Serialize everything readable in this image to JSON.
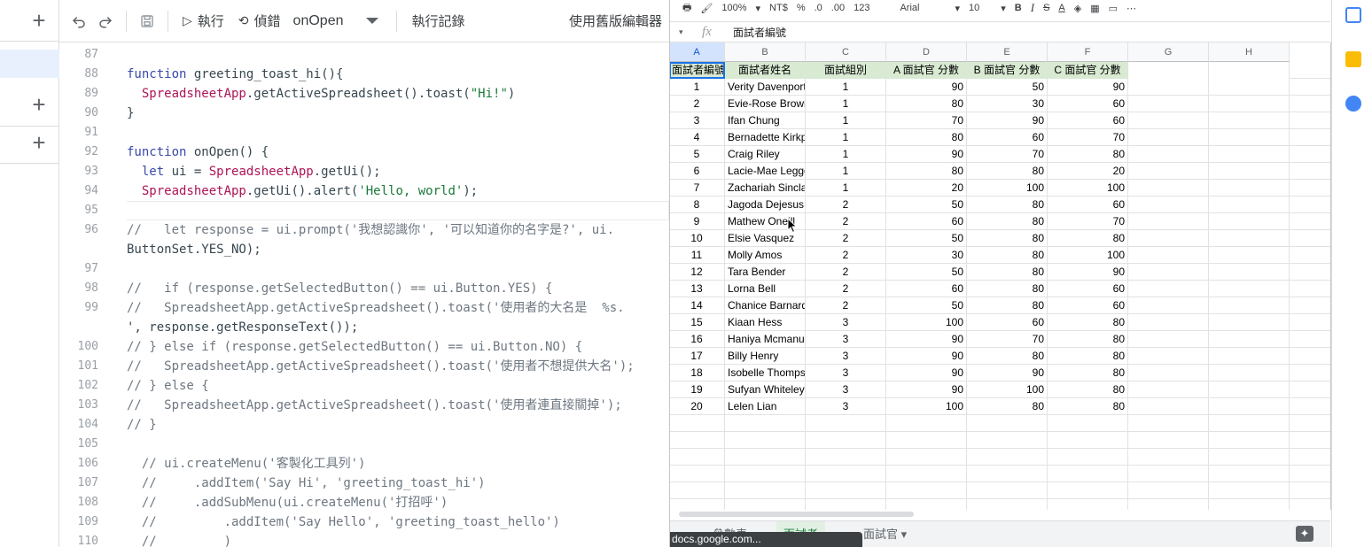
{
  "editor": {
    "toolbar": {
      "undo_icon": "undo-icon",
      "redo_icon": "redo-icon",
      "save_icon": "save-icon",
      "run_label": "執行",
      "debug_label": "偵錯",
      "function_name": "onOpen",
      "exec_log_label": "執行記錄",
      "legacy_label": "使用舊版編輯器"
    },
    "code_lines": [
      {
        "n": "87",
        "t": ""
      },
      {
        "n": "88",
        "t": "function greeting_toast_hi(){"
      },
      {
        "n": "89",
        "t": "  SpreadsheetApp.getActiveSpreadsheet().toast(\"Hi!\")"
      },
      {
        "n": "90",
        "t": "}"
      },
      {
        "n": "91",
        "t": ""
      },
      {
        "n": "92",
        "t": "function onOpen() {"
      },
      {
        "n": "93",
        "t": "  let ui = SpreadsheetApp.getUi();"
      },
      {
        "n": "94",
        "t": "  SpreadsheetApp.getUi().alert('Hello, world');"
      },
      {
        "n": "95",
        "t": ""
      },
      {
        "n": "96",
        "t": "//   let response = ui.prompt('我想認識你', '可以知道你的名字是?', ui."
      },
      {
        "n": "",
        "t": "ButtonSet.YES_NO);"
      },
      {
        "n": "97",
        "t": ""
      },
      {
        "n": "98",
        "t": "//   if (response.getSelectedButton() == ui.Button.YES) {"
      },
      {
        "n": "99",
        "t": "//   SpreadsheetApp.getActiveSpreadsheet().toast('使用者的大名是  %s."
      },
      {
        "n": "",
        "t": "', response.getResponseText());"
      },
      {
        "n": "100",
        "t": "// } else if (response.getSelectedButton() == ui.Button.NO) {"
      },
      {
        "n": "101",
        "t": "//   SpreadsheetApp.getActiveSpreadsheet().toast('使用者不想提供大名');"
      },
      {
        "n": "102",
        "t": "// } else {"
      },
      {
        "n": "103",
        "t": "//   SpreadsheetApp.getActiveSpreadsheet().toast('使用者連直接關掉');"
      },
      {
        "n": "104",
        "t": "// }"
      },
      {
        "n": "105",
        "t": ""
      },
      {
        "n": "106",
        "t": "  // ui.createMenu('客製化工具列')"
      },
      {
        "n": "107",
        "t": "  //     .addItem('Say Hi', 'greeting_toast_hi')"
      },
      {
        "n": "108",
        "t": "  //     .addSubMenu(ui.createMenu('打招呼')"
      },
      {
        "n": "109",
        "t": "  //         .addItem('Say Hello', 'greeting_toast_hello')"
      },
      {
        "n": "110",
        "t": "  //         )"
      }
    ]
  },
  "sheets": {
    "format_bar": {
      "zoom": "100%",
      "currency": "NT$",
      "percent": "%",
      "dec_minus": ".0",
      "dec_plus": ".00",
      "more_formats": "123",
      "font": "Arial",
      "font_size": "10",
      "bold": "B",
      "italic": "I",
      "strike": "S",
      "text_color": "A",
      "more": "⋯"
    },
    "formula_bar": {
      "fx": "fx",
      "value": "面試者編號"
    },
    "columns": [
      "A",
      "B",
      "C",
      "D",
      "E",
      "F",
      "G",
      "H"
    ],
    "header": [
      "面試者編號",
      "面試者姓名",
      "面試組別",
      "A 面試官 分數",
      "B 面試官 分數",
      "C 面試官 分數"
    ],
    "rows": [
      [
        "1",
        "Verity Davenport",
        "1",
        "90",
        "50",
        "90"
      ],
      [
        "2",
        "Evie-Rose Brown",
        "1",
        "80",
        "30",
        "60"
      ],
      [
        "3",
        "Ifan Chung",
        "1",
        "70",
        "90",
        "60"
      ],
      [
        "4",
        "Bernadette Kirkpatrick",
        "1",
        "80",
        "60",
        "70"
      ],
      [
        "5",
        "Craig Riley",
        "1",
        "90",
        "70",
        "80"
      ],
      [
        "6",
        "Lacie-Mae Leggett",
        "1",
        "80",
        "80",
        "20"
      ],
      [
        "7",
        "Zachariah Sinclair",
        "1",
        "20",
        "100",
        "100"
      ],
      [
        "8",
        "Jagoda Dejesus",
        "2",
        "50",
        "80",
        "60"
      ],
      [
        "9",
        "Mathew Oneill",
        "2",
        "60",
        "80",
        "70"
      ],
      [
        "10",
        "Elsie Vasquez",
        "2",
        "50",
        "80",
        "80"
      ],
      [
        "11",
        "Molly Amos",
        "2",
        "30",
        "80",
        "100"
      ],
      [
        "12",
        "Tara Bender",
        "2",
        "50",
        "80",
        "90"
      ],
      [
        "13",
        "Lorna Bell",
        "2",
        "60",
        "80",
        "60"
      ],
      [
        "14",
        "Chanice Barnard",
        "2",
        "50",
        "80",
        "60"
      ],
      [
        "15",
        "Kiaan Hess",
        "3",
        "100",
        "60",
        "80"
      ],
      [
        "16",
        "Haniya Mcmanus",
        "3",
        "90",
        "70",
        "80"
      ],
      [
        "17",
        "Billy Henry",
        "3",
        "90",
        "80",
        "80"
      ],
      [
        "18",
        "Isobelle Thompson",
        "3",
        "90",
        "90",
        "80"
      ],
      [
        "19",
        "Sufyan Whiteley",
        "3",
        "90",
        "100",
        "80"
      ],
      [
        "20",
        "Lelen Lian",
        "3",
        "100",
        "80",
        "80"
      ]
    ],
    "tabs": [
      {
        "label": "參數表",
        "active": false
      },
      {
        "label": "面試者",
        "active": true
      },
      {
        "label": "面試官",
        "active": false
      }
    ],
    "status_url": "docs.google.com...",
    "colors": {
      "header_fill": "#d9ead3",
      "selection": "#1a73e8",
      "active_tab": "#188038"
    }
  }
}
